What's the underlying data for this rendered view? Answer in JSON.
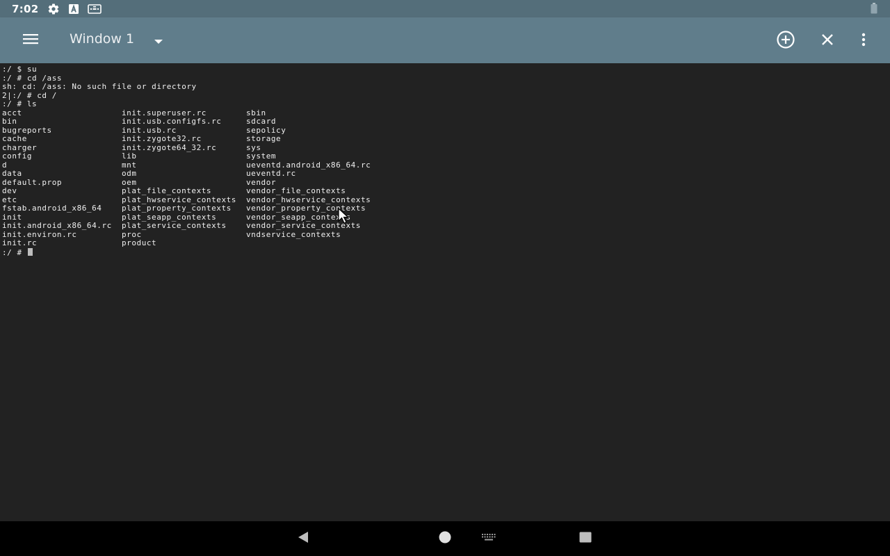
{
  "status_bar": {
    "time": "7:02",
    "icons": [
      "settings-icon",
      "font-a-icon",
      "keyboard-status-icon",
      "battery-icon"
    ]
  },
  "app_bar": {
    "window_title": "Window 1",
    "icons": [
      "hamburger-menu-icon",
      "dropdown-arrow-icon",
      "add-circle-icon",
      "close-icon",
      "more-vert-icon"
    ]
  },
  "terminal": {
    "lines": [
      ":/ $ su",
      ":/ # cd /ass",
      "sh: cd: /ass: No such file or directory",
      "2|:/ # cd /",
      ":/ # ls"
    ],
    "ls_columns": [
      [
        "acct",
        "bin",
        "bugreports",
        "cache",
        "charger",
        "config",
        "d",
        "data",
        "default.prop",
        "dev",
        "etc",
        "fstab.android_x86_64",
        "init",
        "init.android_x86_64.rc",
        "init.environ.rc",
        "init.rc"
      ],
      [
        "init.superuser.rc",
        "init.usb.configfs.rc",
        "init.usb.rc",
        "init.zygote32.rc",
        "init.zygote64_32.rc",
        "lib",
        "mnt",
        "odm",
        "oem",
        "plat_file_contexts",
        "plat_hwservice_contexts",
        "plat_property_contexts",
        "plat_seapp_contexts",
        "plat_service_contexts",
        "proc",
        "product"
      ],
      [
        "sbin",
        "sdcard",
        "sepolicy",
        "storage",
        "sys",
        "system",
        "ueventd.android_x86_64.rc",
        "ueventd.rc",
        "vendor",
        "vendor_file_contexts",
        "vendor_hwservice_contexts",
        "vendor_property_contexts",
        "vendor_seapp_contexts",
        "vendor_service_contexts",
        "vndservice_contexts"
      ]
    ],
    "prompt": ":/ # ",
    "colors": {
      "background": "#222222",
      "foreground": "#F0F0F0"
    }
  },
  "nav_bar": {
    "icons": [
      "back-icon",
      "home-icon",
      "keyboard-icon",
      "recents-icon"
    ]
  },
  "colors": {
    "status_bar": "#546E7A",
    "app_bar": "#607D8B",
    "nav_bar": "#000000"
  }
}
